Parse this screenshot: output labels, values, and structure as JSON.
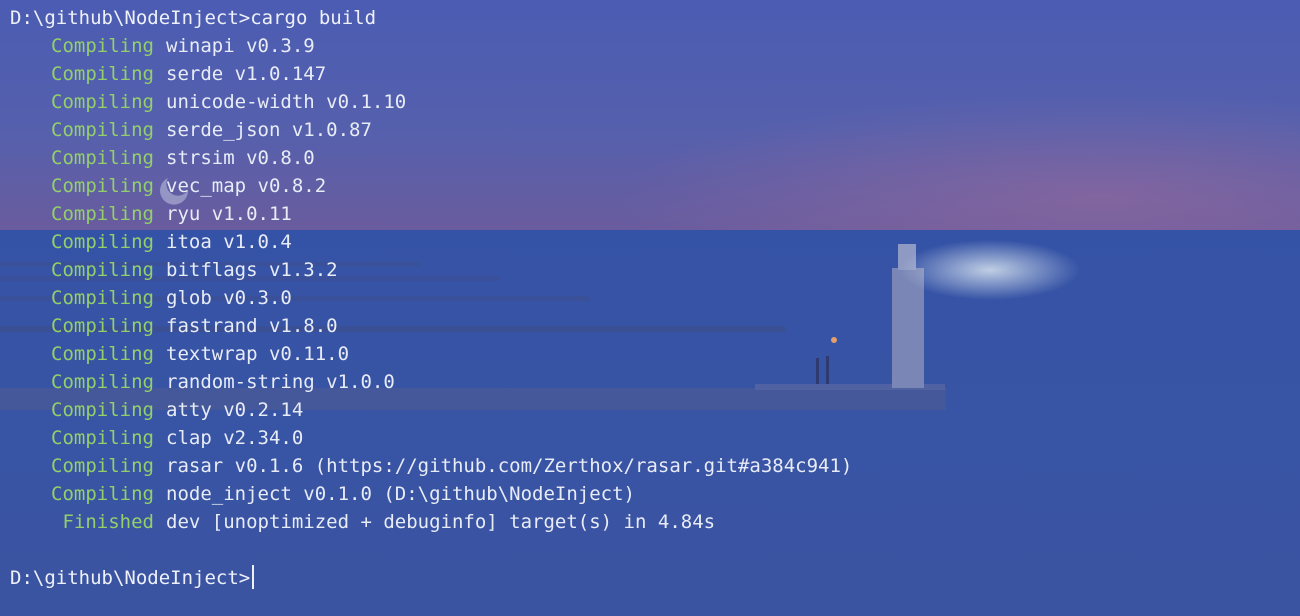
{
  "terminal": {
    "command_line": "D:\\github\\NodeInject>cargo build",
    "output": [
      {
        "status": "Compiling",
        "text": "winapi v0.3.9"
      },
      {
        "status": "Compiling",
        "text": "serde v1.0.147"
      },
      {
        "status": "Compiling",
        "text": "unicode-width v0.1.10"
      },
      {
        "status": "Compiling",
        "text": "serde_json v1.0.87"
      },
      {
        "status": "Compiling",
        "text": "strsim v0.8.0"
      },
      {
        "status": "Compiling",
        "text": "vec_map v0.8.2"
      },
      {
        "status": "Compiling",
        "text": "ryu v1.0.11"
      },
      {
        "status": "Compiling",
        "text": "itoa v1.0.4"
      },
      {
        "status": "Compiling",
        "text": "bitflags v1.3.2"
      },
      {
        "status": "Compiling",
        "text": "glob v0.3.0"
      },
      {
        "status": "Compiling",
        "text": "fastrand v1.8.0"
      },
      {
        "status": "Compiling",
        "text": "textwrap v0.11.0"
      },
      {
        "status": "Compiling",
        "text": "random-string v1.0.0"
      },
      {
        "status": "Compiling",
        "text": "atty v0.2.14"
      },
      {
        "status": "Compiling",
        "text": "clap v2.34.0"
      },
      {
        "status": "Compiling",
        "text": "rasar v0.1.6 (https://github.com/Zerthox/rasar.git#a384c941)"
      },
      {
        "status": "Compiling",
        "text": "node_inject v0.1.0 (D:\\github\\NodeInject)"
      },
      {
        "status": "Finished",
        "text": "dev [unoptimized + debuginfo] target(s) in 4.84s"
      }
    ],
    "prompt": "D:\\github\\NodeInject>"
  },
  "colors": {
    "status_green": "#93cf6a",
    "text": "#e8ecf6",
    "background_sky": "#4a5cb0",
    "background_sea": "#3650a0"
  }
}
